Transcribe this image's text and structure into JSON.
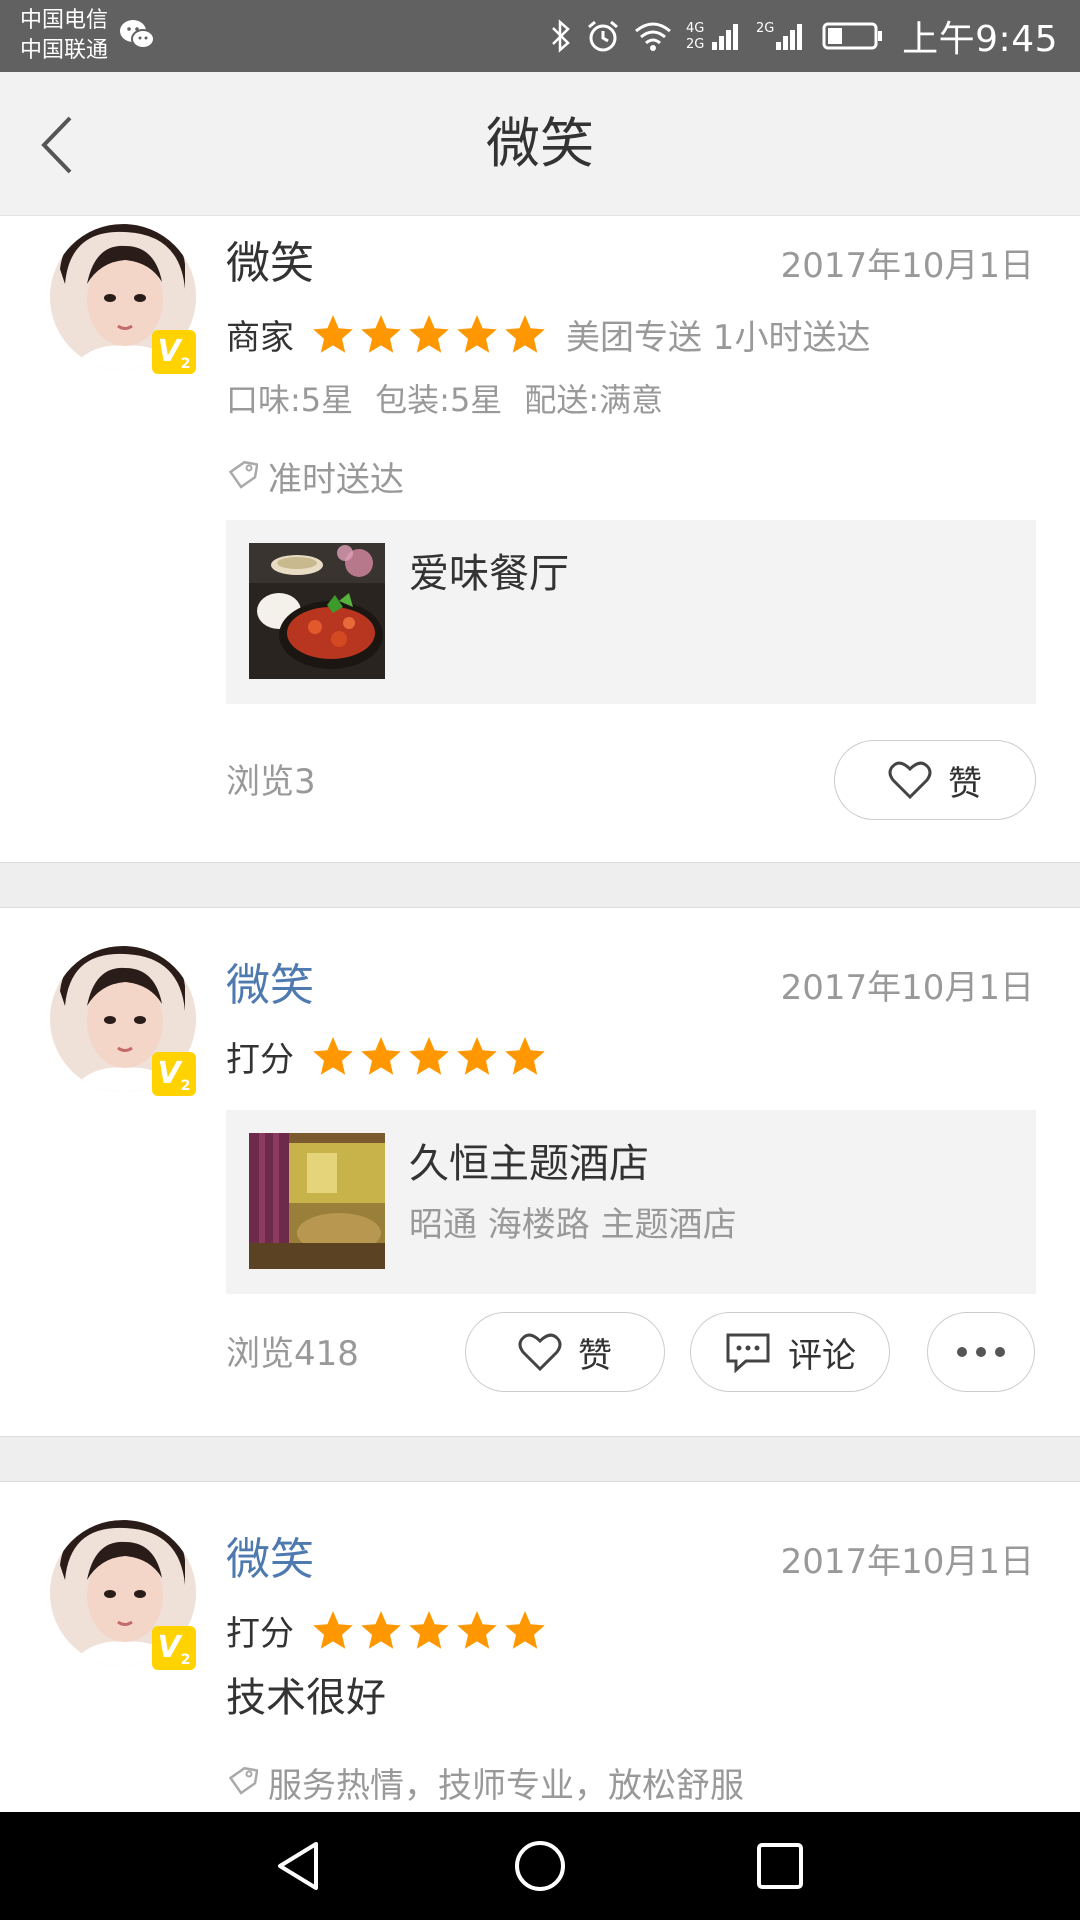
{
  "status_bar": {
    "carrier_1": "中国电信",
    "carrier_2": "中国联通",
    "network_1": "4G",
    "network_1b": "2G",
    "network_2": "2G",
    "time": "上午9:45"
  },
  "header": {
    "title": "微笑"
  },
  "posts": [
    {
      "username": "微笑",
      "date": "2017年10月1日",
      "badge": "V",
      "badge_level": "2",
      "rating_label": "商家",
      "stars": 5,
      "delivery": "美团专送 1小时送达",
      "sub_ratings": [
        "口味:5星",
        "包装:5星",
        "配送:满意"
      ],
      "tag": "准时送达",
      "shop_name": "爱味餐厅",
      "views": "浏览3",
      "like_label": "赞"
    },
    {
      "username": "微笑",
      "date": "2017年10月1日",
      "badge": "V",
      "badge_level": "2",
      "rating_label": "打分",
      "stars": 5,
      "shop_name": "久恒主题酒店",
      "shop_sub": "昭通 海楼路 主题酒店",
      "views": "浏览418",
      "like_label": "赞",
      "comment_label": "评论"
    },
    {
      "username": "微笑",
      "date": "2017年10月1日",
      "badge": "V",
      "badge_level": "2",
      "rating_label": "打分",
      "stars": 5,
      "content": "技术很好",
      "tag": "服务热情，技师专业，放松舒服"
    }
  ],
  "colors": {
    "status_bar": "#616161",
    "title_bar": "#f2f2f2",
    "star": "#ff9800",
    "link_name": "#4f7ab0",
    "badge": "#ffd200",
    "nav_bar": "#000000"
  }
}
